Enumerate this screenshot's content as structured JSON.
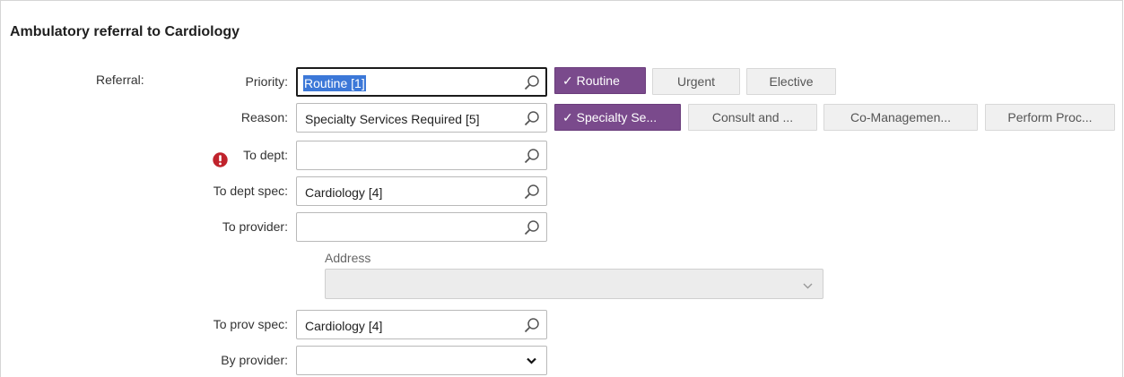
{
  "header": {
    "title": "Ambulatory referral to Cardiology"
  },
  "section": {
    "label": "Referral:"
  },
  "priority": {
    "label": "Priority:",
    "value": "Routine [1]",
    "options": [
      {
        "label": "✓ Routine",
        "selected": true
      },
      {
        "label": "Urgent",
        "selected": false
      },
      {
        "label": "Elective",
        "selected": false
      }
    ]
  },
  "reason": {
    "label": "Reason:",
    "value": "Specialty Services Required [5]",
    "options": [
      {
        "label": "✓ Specialty Se...",
        "selected": true
      },
      {
        "label": "Consult and ...",
        "selected": false
      },
      {
        "label": "Co-Managemen...",
        "selected": false
      },
      {
        "label": "Perform Proc...",
        "selected": false
      }
    ]
  },
  "to_dept": {
    "label": "To dept:",
    "value": "",
    "required": true
  },
  "to_dept_spec": {
    "label": "To dept spec:",
    "value": "Cardiology [4]"
  },
  "to_provider": {
    "label": "To provider:",
    "value": ""
  },
  "address": {
    "label": "Address",
    "value": ""
  },
  "to_prov_spec": {
    "label": "To prov spec:",
    "value": "Cardiology [4]"
  },
  "by_provider": {
    "label": "By provider:",
    "value": ""
  },
  "colors": {
    "selected_button": "#7a4a8c",
    "unselected_button": "#f0f0f0",
    "text_selection": "#3c78d8",
    "warning": "#c0232c"
  },
  "icons": {
    "lookup": "magnifier-icon",
    "warning": "exclamation-circle-icon",
    "dropdown": "chevron-down-icon"
  }
}
